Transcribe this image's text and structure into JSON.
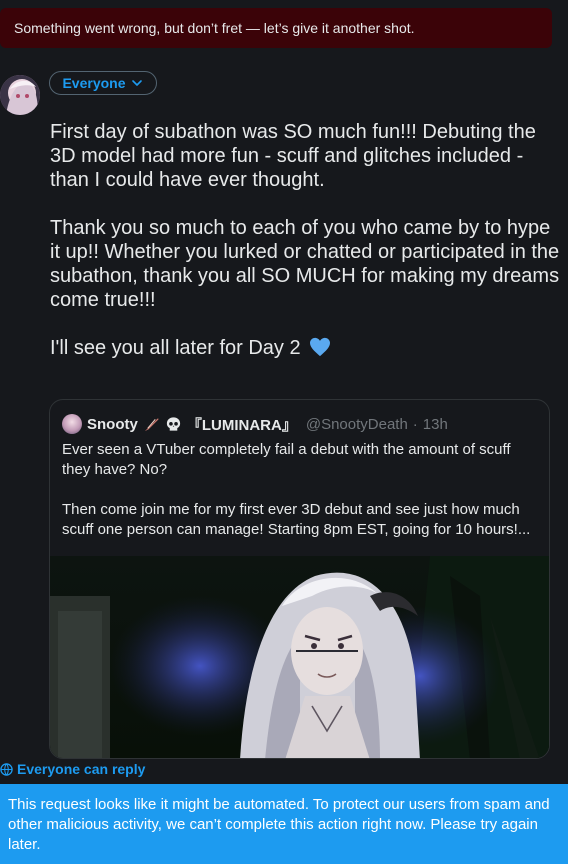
{
  "error_banner": {
    "text": "Something went wrong, but don’t fret — let’s give it another shot."
  },
  "composer": {
    "audience_label": "Everyone",
    "paragraphs": [
      "First day of subathon was SO much fun!!! Debuting the 3D model had more fun - scuff and glitches included - than I could have ever thought.",
      "Thank you so much to each of you who came by to hype it up!! Whether you lurked or chatted or participated in the subathon, thank you all SO MUCH for making my dreams come true!!!",
      "I'll see you all later for Day 2"
    ],
    "heart_color": "#5aa9f0"
  },
  "quote": {
    "name": "Snooty",
    "name_suffix": "『LUMINARA』",
    "handle": "@SnootyDeath",
    "separator": "·",
    "time": "13h",
    "paragraphs": [
      "Ever seen a VTuber completely fail a debut with the amount of scuff they have? No?",
      "Then come join me for my first ever 3D debut and see just how much scuff one person can manage! Starting 8pm EST, going for 10 hours!..."
    ]
  },
  "reply_setting": {
    "label": "Everyone can reply"
  },
  "toast": {
    "text": "This request looks like it might be automated. To protect our users from spam and other malicious activity, we can’t complete this action right now. Please try again later."
  },
  "colors": {
    "background": "#16181c",
    "accent": "#1d9bf0",
    "error_banner": "#3b0308",
    "muted": "#71767b"
  }
}
